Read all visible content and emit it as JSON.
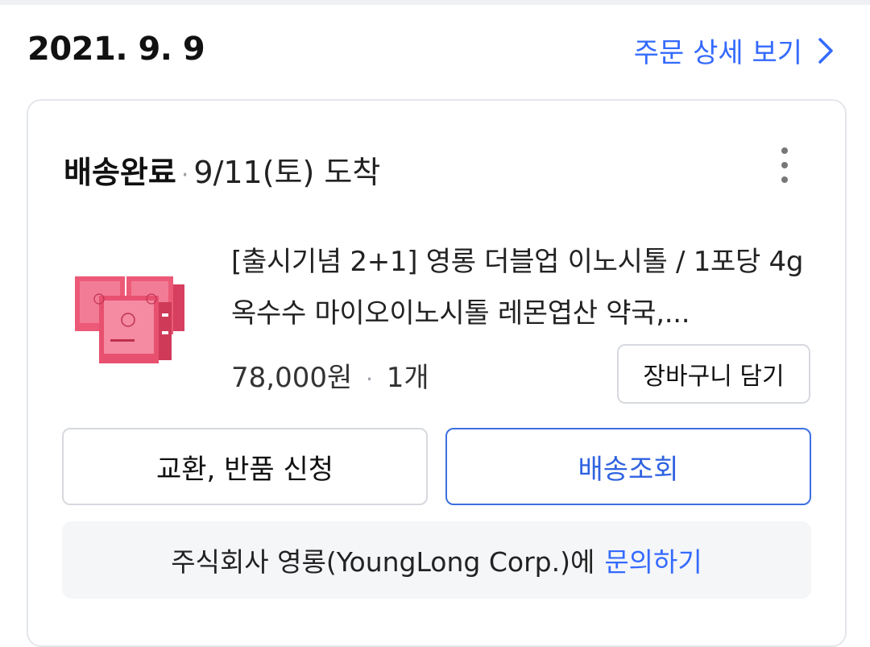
{
  "order": {
    "date": "2021. 9. 9",
    "detail_link": "주문 상세 보기"
  },
  "shipment": {
    "status": "배송완료",
    "separator": "·",
    "arrival": "9/11(토) 도착"
  },
  "product": {
    "name": "[출시기념 2+1] 영롱 더블업 이노시톨 / 1포당 4g 옥수수 마이오이노시톨 레몬엽산 약국,...",
    "price": "78,000원",
    "quantity": "1개",
    "cart_button": "장바구니 담기"
  },
  "actions": {
    "exchange_return": "교환, 반품 신청",
    "tracking": "배송조회"
  },
  "inquiry": {
    "seller_text": "주식회사 영롱(YoungLong Corp.)에",
    "link": "문의하기"
  },
  "colors": {
    "accent": "#346aff",
    "product_pink": "#e8506f"
  }
}
